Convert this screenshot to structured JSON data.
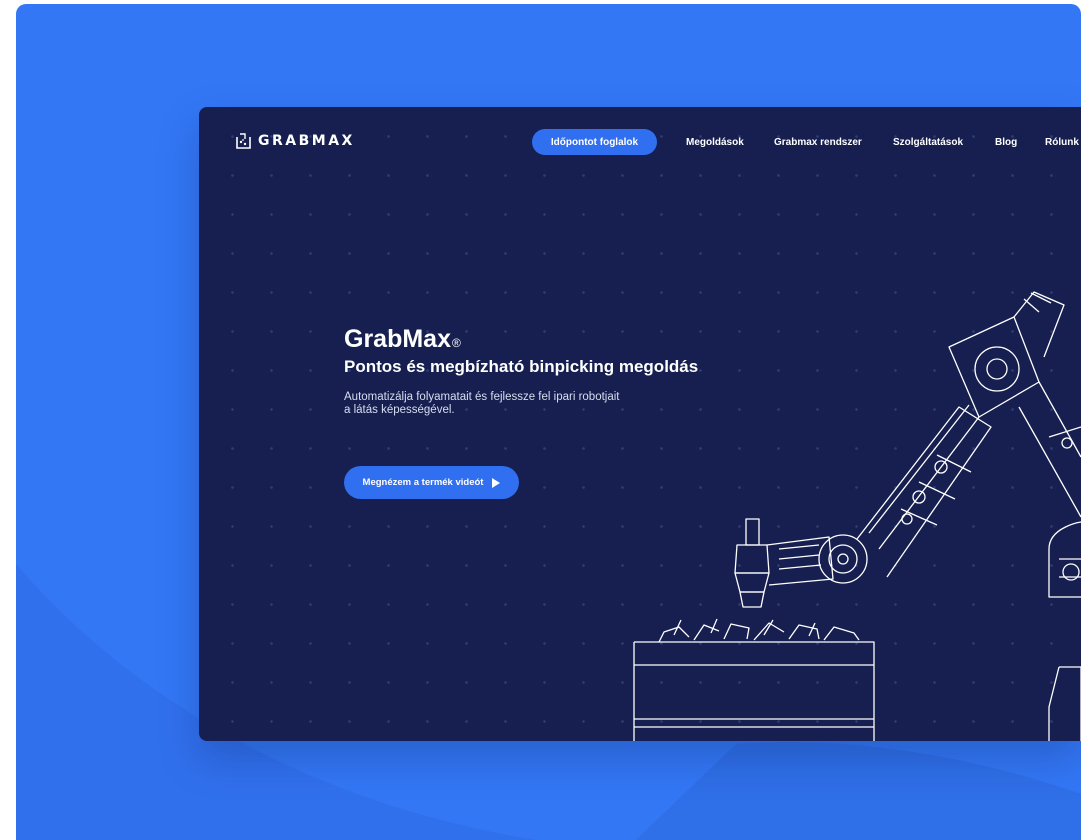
{
  "brand": {
    "name": "GRABMAX"
  },
  "nav": {
    "cta_label": "Időpontot foglalok",
    "links": [
      "Megoldások",
      "Grabmax rendszer",
      "Szolgáltatások",
      "Blog",
      "Rólunk"
    ]
  },
  "hero": {
    "title": "GrabMax",
    "registered": "®",
    "subtitle": "Pontos és megbízható binpicking megoldás",
    "description_line1": "Automatizálja folyamatait és fejlessze fel ipari robotjait",
    "description_line2": "a látás képességével.",
    "button_label": "Megnézem a termék videót"
  },
  "colors": {
    "card_bg": "#3377f5",
    "screen_bg": "#161f4f",
    "accent": "#2f6ff0",
    "text": "#ffffff"
  },
  "icons": {
    "logo": "grabmax-logo-icon",
    "play": "play-icon",
    "illustration": "robot-arm-illustration"
  }
}
